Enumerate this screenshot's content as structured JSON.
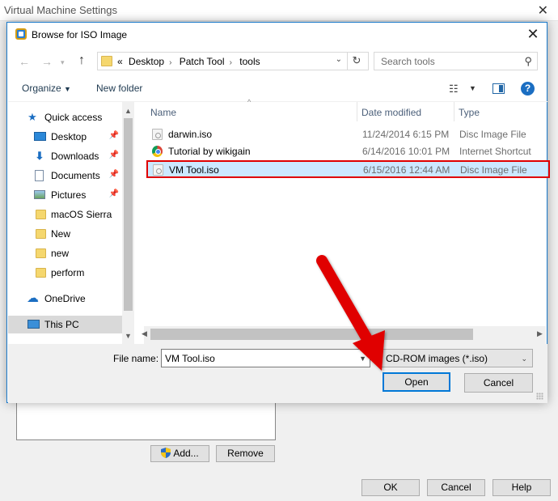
{
  "background_window": {
    "title": "Virtual Machine Settings",
    "add_label": "Add...",
    "remove_label": "Remove",
    "ok_label": "OK",
    "cancel_label": "Cancel",
    "help_label": "Help"
  },
  "dialog": {
    "title": "Browse for ISO Image",
    "address": {
      "overflow": "«",
      "crumbs": [
        "Desktop",
        "Patch Tool",
        "tools"
      ]
    },
    "search_placeholder": "Search tools",
    "toolbar": {
      "organize_label": "Organize",
      "new_folder_label": "New folder"
    },
    "nav_items": [
      {
        "label": "Quick access",
        "icon": "star-icon",
        "pinned": false
      },
      {
        "label": "Desktop",
        "icon": "desktop-icon",
        "pinned": true
      },
      {
        "label": "Downloads",
        "icon": "download-icon",
        "pinned": true
      },
      {
        "label": "Documents",
        "icon": "documents-icon",
        "pinned": true
      },
      {
        "label": "Pictures",
        "icon": "pictures-icon",
        "pinned": true
      },
      {
        "label": "macOS Sierra",
        "icon": "folder-icon",
        "pinned": false
      },
      {
        "label": "New",
        "icon": "folder-icon",
        "pinned": false
      },
      {
        "label": "new",
        "icon": "folder-icon",
        "pinned": false
      },
      {
        "label": "perform",
        "icon": "folder-icon",
        "pinned": false
      },
      {
        "label": "OneDrive",
        "icon": "cloud-icon",
        "pinned": false
      },
      {
        "label": "This PC",
        "icon": "computer-icon",
        "pinned": false,
        "selected": true
      }
    ],
    "columns": {
      "name": "Name",
      "date": "Date modified",
      "type": "Type"
    },
    "files": [
      {
        "name": "darwin.iso",
        "date": "11/24/2014 6:15 PM",
        "type": "Disc Image File",
        "icon": "disc-image-icon"
      },
      {
        "name": "Tutorial by wikigain",
        "date": "6/14/2016 10:01 PM",
        "type": "Internet Shortcut",
        "icon": "chrome-icon"
      },
      {
        "name": "VM Tool.iso",
        "date": "6/15/2016 12:44 AM",
        "type": "Disc Image File",
        "icon": "disc-image-icon",
        "selected": true
      }
    ],
    "file_name_label": "File name:",
    "file_name_value": "VM Tool.iso",
    "filter_value": "CD-ROM images (*.iso)",
    "open_label": "Open",
    "cancel_label": "Cancel"
  },
  "colors": {
    "accent": "#0078d7",
    "annotation": "#e00000",
    "selection": "#cce8ff"
  }
}
